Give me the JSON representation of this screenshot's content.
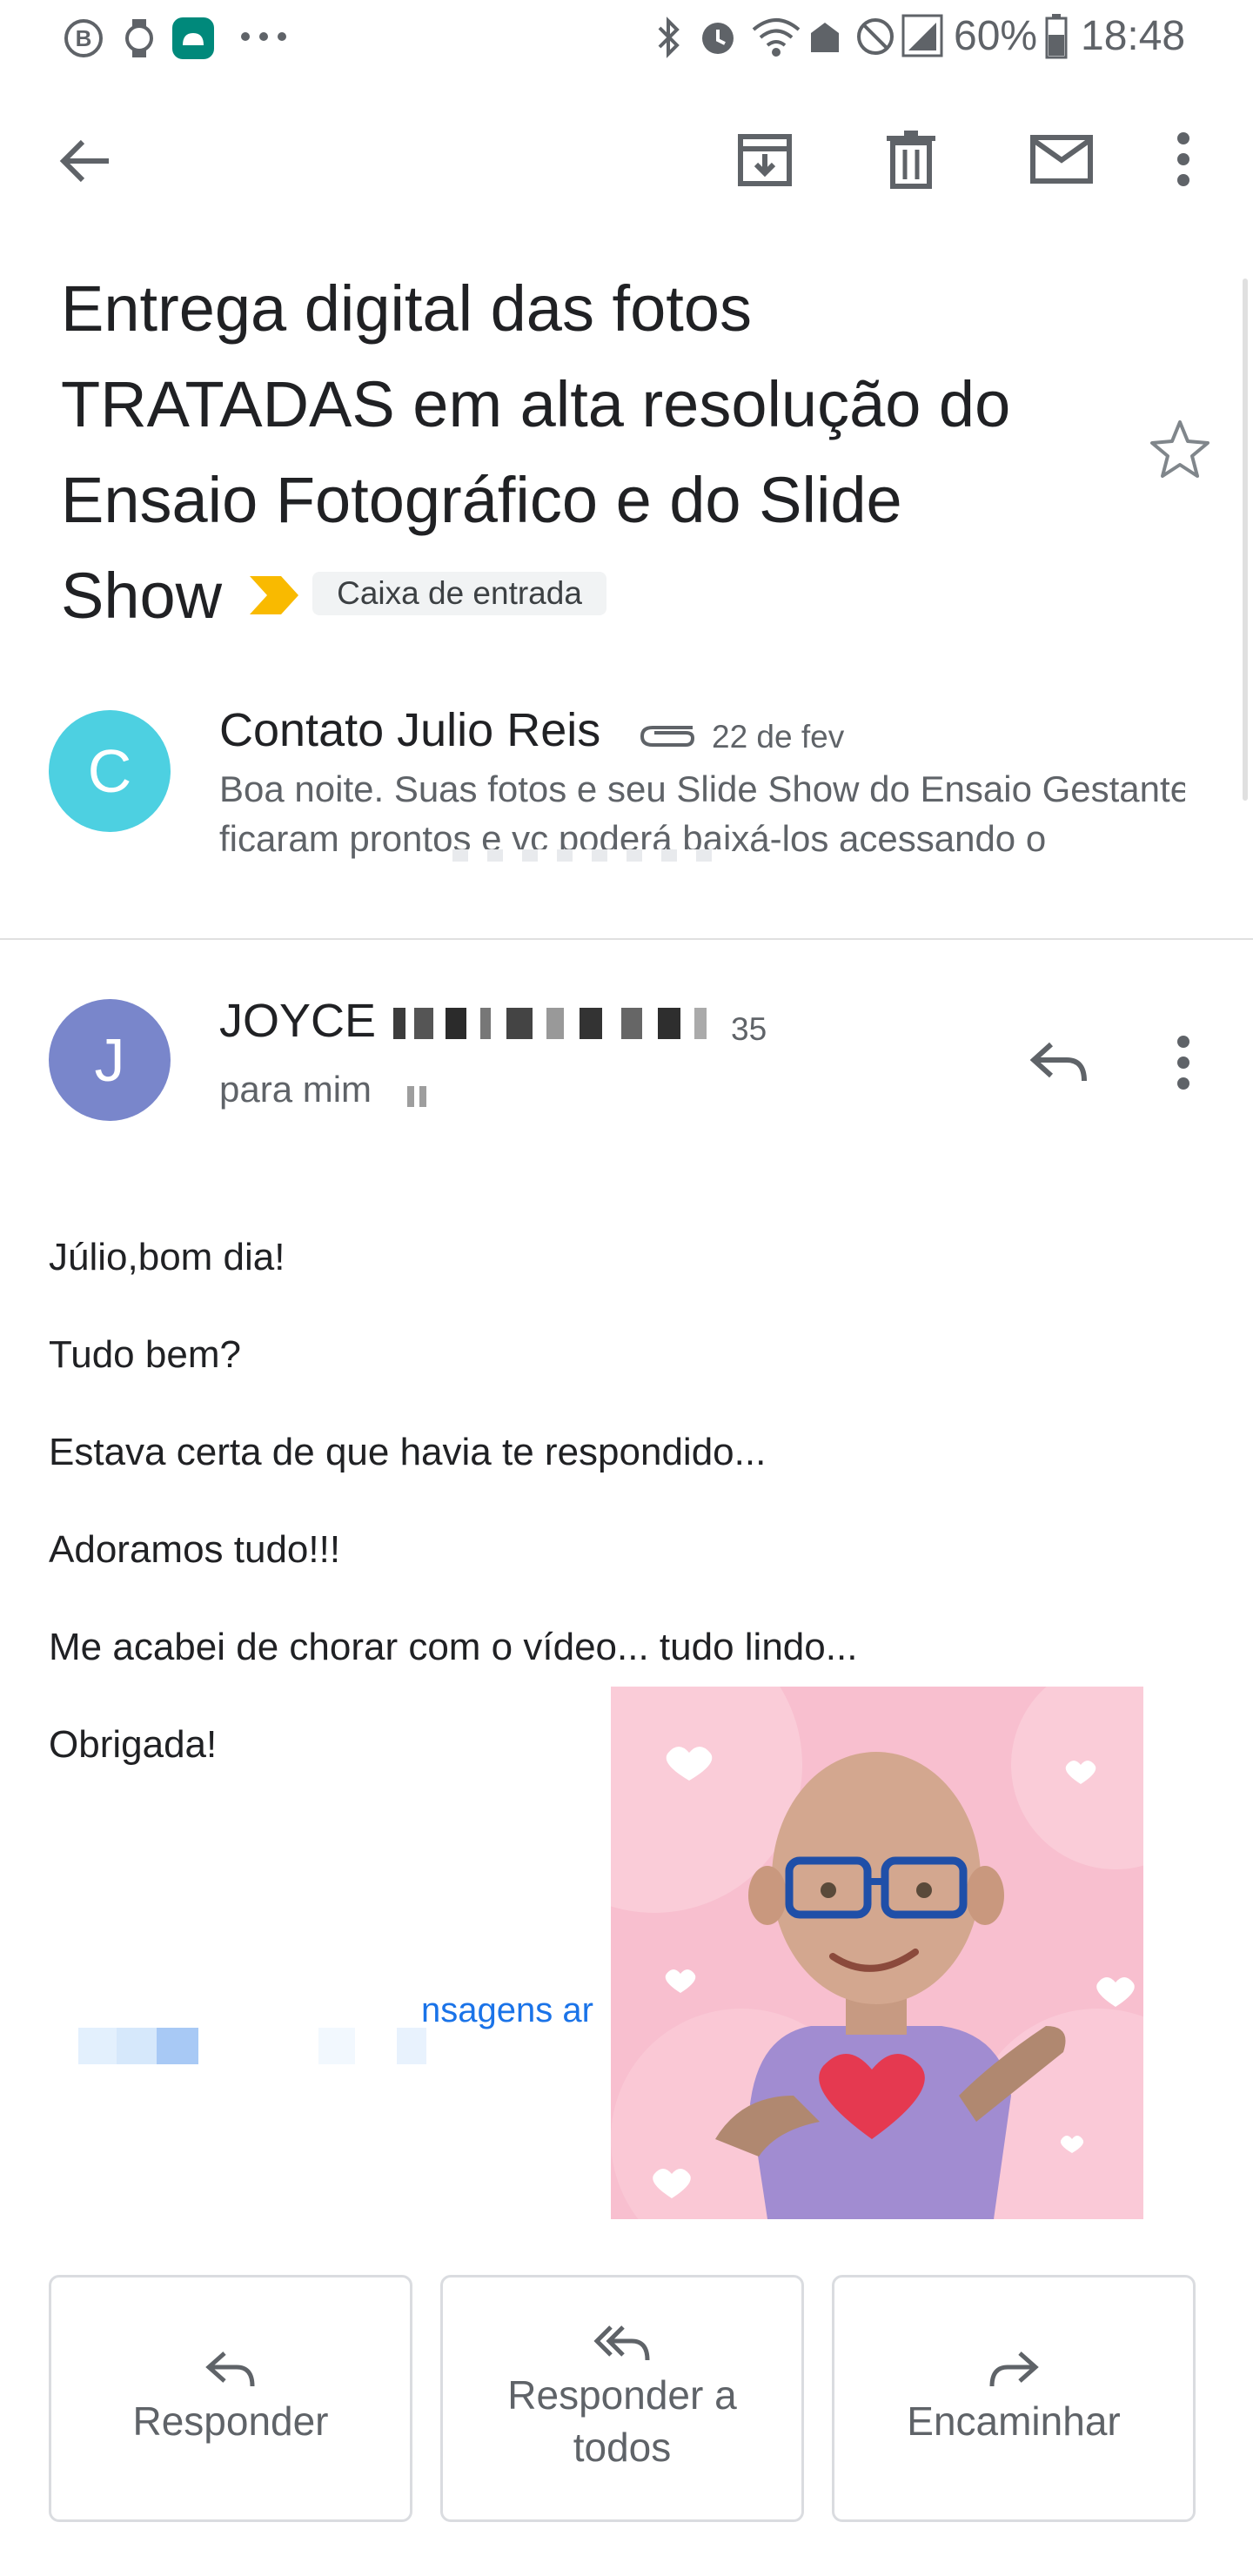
{
  "status_bar": {
    "battery": "60%",
    "time": "18:48"
  },
  "email": {
    "subject_lines": [
      "Entrega digital das fotos",
      "TRATADAS em alta resolução do",
      "Ensaio Fotográfico e do Slide",
      "Show"
    ],
    "label": "Caixa de entrada",
    "collapsed_message": {
      "avatar_letter": "C",
      "avatar_color": "#4dd0e1",
      "sender": "Contato Julio Reis",
      "date": "22 de fev",
      "snippet_lines": [
        "Boa noite. Suas fotos e seu Slide Show do Ensaio Gestante",
        "ficaram prontos e vc poderá baixá-los acessando o"
      ]
    },
    "expanded_message": {
      "avatar_letter": "J",
      "avatar_color": "#7986cb",
      "sender": "JOYCE",
      "date_partial": "35",
      "recipient": "para mim",
      "body_lines": [
        "Júlio,bom dia!",
        "Tudo bem?",
        "Estava certa de que havia te respondido...",
        "Adoramos tudo!!!",
        "Me acabei de chorar com o vídeo... tudo lindo...",
        "Obrigada!"
      ],
      "quoted_link_partial": "nsagens ar"
    }
  },
  "actions": {
    "reply": "Responder",
    "reply_all_lines": [
      "Responder a",
      "todos"
    ],
    "forward": "Encaminhar"
  },
  "colors": {
    "icon_gray": "#5f6368",
    "important_yellow": "#f9ba00",
    "link_blue": "#1a73e8",
    "sticker_bg": "#f8bfcf"
  }
}
